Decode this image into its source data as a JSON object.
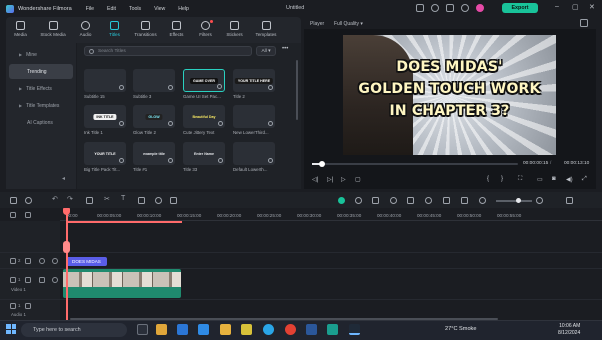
{
  "app": {
    "name": "Wondershare Filmora",
    "document_title": "Untitled",
    "menu": [
      "File",
      "Edit",
      "Tools",
      "View",
      "Help"
    ],
    "export_label": "Export"
  },
  "media_tabs": [
    {
      "label": "Media",
      "icon": "media-icon"
    },
    {
      "label": "Stock Media",
      "icon": "stock-media-icon"
    },
    {
      "label": "Audio",
      "icon": "music-icon"
    },
    {
      "label": "Titles",
      "icon": "titles-icon",
      "active": true
    },
    {
      "label": "Transitions",
      "icon": "transitions-icon"
    },
    {
      "label": "Effects",
      "icon": "effects-icon"
    },
    {
      "label": "Filters",
      "icon": "filters-icon"
    },
    {
      "label": "Stickers",
      "icon": "stickers-icon"
    },
    {
      "label": "Templates",
      "icon": "templates-icon"
    }
  ],
  "sidebar": {
    "items": [
      {
        "label": "Mine",
        "chevron": true
      },
      {
        "label": "Trending",
        "active": true
      },
      {
        "label": "Title Effects",
        "chevron": true
      },
      {
        "label": "Title Templates",
        "chevron": true
      },
      {
        "label": "AI Captions"
      }
    ]
  },
  "search": {
    "placeholder": "Search Titles",
    "filter": "All"
  },
  "titles_grid": [
    {
      "label": "Subtitle 15",
      "chip": "",
      "chip_bg": "#2b2f36",
      "chip_fg": "#ffffff"
    },
    {
      "label": "Subtitle 3",
      "chip": "",
      "chip_bg": "#2b2f36",
      "chip_fg": "#ffffff"
    },
    {
      "label": "Game UI Set Pac...",
      "chip": "GAME OVER",
      "chip_bg": "#111111",
      "chip_fg": "#ffffff",
      "selected": true
    },
    {
      "label": "Title 2",
      "chip": "YOUR TITLE HERE",
      "chip_bg": "#1a1a1a",
      "chip_fg": "#ffffff"
    },
    {
      "label": "Ink Title 1",
      "chip": "INK TITLE",
      "chip_bg": "#f2f2f2",
      "chip_fg": "#111111"
    },
    {
      "label": "Glow Title 2",
      "chip": "GLOW",
      "chip_bg": "#222222",
      "chip_fg": "#7ff0ff"
    },
    {
      "label": "Cute Jittery Text",
      "chip": "Beautiful Day",
      "chip_bg": "#2b2f36",
      "chip_fg": "#f5e663"
    },
    {
      "label": "New LowerThird...",
      "chip": "",
      "chip_bg": "#2b2f36",
      "chip_fg": "#ffffff"
    },
    {
      "label": "Big Title Pack Tit...",
      "chip": "YOUR TITLE",
      "chip_bg": "#2b2f36",
      "chip_fg": "#ffffff"
    },
    {
      "label": "Title #1",
      "chip": "example title",
      "chip_bg": "#2b2f36",
      "chip_fg": "#e6e8ec"
    },
    {
      "label": "Title 33",
      "chip": "Enter Name",
      "chip_bg": "#2b2f36",
      "chip_fg": "#e6e8ec"
    },
    {
      "label": "Default Lowerth...",
      "chip": "",
      "chip_bg": "#2b2f36",
      "chip_fg": "#ffffff"
    }
  ],
  "player": {
    "label": "Player",
    "quality": "Full Quality",
    "caption_lines": [
      "DOES MIDAS'",
      "GOLDEN TOUCH WORK",
      "IN CHAPTER 3?"
    ],
    "current_time": "00:00:00:15",
    "total_time": "00:00:13:10",
    "progress": 0.05
  },
  "ruler": {
    "ticks": [
      "00:00",
      "00:00:05:00",
      "00:00:10:00",
      "00:00:15:00",
      "00:00:20:00",
      "00:00:25:00",
      "00:00:30:00",
      "00:00:35:00",
      "00:00:40:00",
      "00:00:45:00",
      "00:00:50:00",
      "00:00:55:00"
    ]
  },
  "tracks": {
    "title_clip": "DOES MIDAS",
    "video_label": "Video 1",
    "audio_label": "Audio 1",
    "track_numbers": [
      "2",
      "1",
      "1"
    ]
  },
  "taskbar": {
    "search_placeholder": "Type here to search",
    "weather": "27°C  Smoke",
    "time": "10:06 AM",
    "date": "8/12/2024"
  },
  "colors": {
    "accent": "#19c39a",
    "active_tab": "#28c8d8",
    "playhead": "#ff6b6b",
    "title_clip": "#5a5de8",
    "video_clip": "#1f8a6e",
    "caption_text": "#fff6c2"
  }
}
